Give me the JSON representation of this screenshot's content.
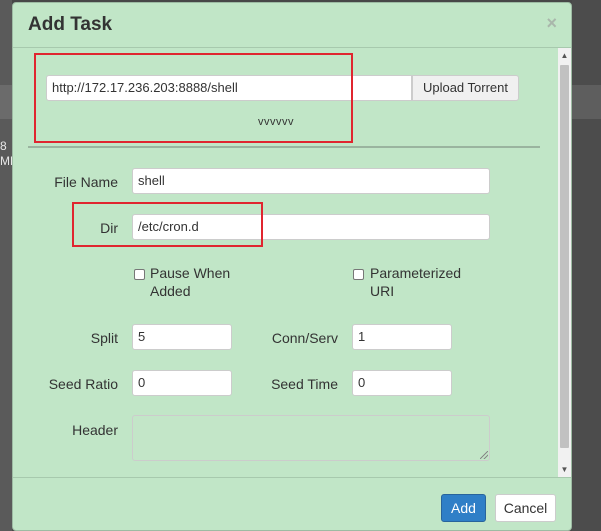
{
  "background": {
    "fragment_top": "8",
    "fragment_bottom": "MB"
  },
  "dialog": {
    "title": "Add Task",
    "close_glyph": "×"
  },
  "task_url": {
    "value": "http://172.17.236.203:8888/shell",
    "upload_label": "Upload Torrent",
    "expand_toggle": "vvvvvv"
  },
  "form": {
    "file_name": {
      "label": "File Name",
      "value": "shell"
    },
    "dir": {
      "label": "Dir",
      "value": "/etc/cron.d"
    },
    "pause_when_added": {
      "line1": "Pause When",
      "line2": "Added",
      "checked": false
    },
    "parameterized_uri": {
      "line1": "Parameterized",
      "line2": "URI",
      "checked": false
    },
    "split": {
      "label": "Split",
      "value": "5"
    },
    "conn_serv": {
      "label": "Conn/Serv",
      "value": "1"
    },
    "seed_ratio": {
      "label": "Seed Ratio",
      "value": "0"
    },
    "seed_time": {
      "label": "Seed Time",
      "value": "0"
    },
    "header": {
      "label": "Header",
      "value": ""
    }
  },
  "footer": {
    "add_label": "Add",
    "cancel_label": "Cancel"
  },
  "scrollbar": {
    "up_glyph": "▲",
    "down_glyph": "▼"
  },
  "colors": {
    "dialog_bg": "#c1e6c7",
    "primary": "#2f7fc7",
    "highlight": "#e0252f",
    "overlay": "#474747"
  }
}
